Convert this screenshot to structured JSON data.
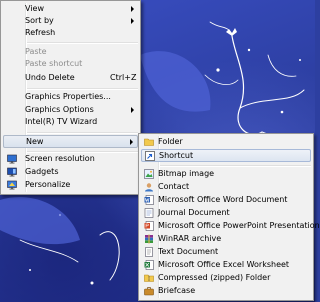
{
  "main_menu": {
    "view": "View",
    "sort_by": "Sort by",
    "refresh": "Refresh",
    "paste": "Paste",
    "paste_shortcut": "Paste shortcut",
    "undo_delete": "Undo Delete",
    "undo_shortcut": "Ctrl+Z",
    "graphics_properties": "Graphics Properties...",
    "graphics_options": "Graphics Options",
    "intel_tv_wizard": "Intel(R) TV Wizard",
    "new": "New",
    "screen_resolution": "Screen resolution",
    "gadgets": "Gadgets",
    "personalize": "Personalize"
  },
  "new_submenu": {
    "items": [
      {
        "label": "Folder",
        "icon": "folder-icon"
      },
      {
        "label": "Shortcut",
        "icon": "shortcut-icon"
      },
      {
        "label": "Bitmap image",
        "icon": "bitmap-icon"
      },
      {
        "label": "Contact",
        "icon": "contact-icon"
      },
      {
        "label": "Microsoft Office Word Document",
        "icon": "word-icon"
      },
      {
        "label": "Journal Document",
        "icon": "journal-icon"
      },
      {
        "label": "Microsoft Office PowerPoint Presentation",
        "icon": "powerpoint-icon"
      },
      {
        "label": "WinRAR archive",
        "icon": "winrar-icon"
      },
      {
        "label": "Text Document",
        "icon": "text-document-icon"
      },
      {
        "label": "Microsoft Office Excel Worksheet",
        "icon": "excel-icon"
      },
      {
        "label": "Compressed (zipped) Folder",
        "icon": "zip-folder-icon"
      },
      {
        "label": "Briefcase",
        "icon": "briefcase-icon"
      }
    ]
  },
  "colors": {
    "desktop": "#2d3fa0",
    "menu_bg": "#f1f1f1",
    "highlight_border": "#aeb9c9",
    "disabled_text": "#8c8c8c"
  }
}
